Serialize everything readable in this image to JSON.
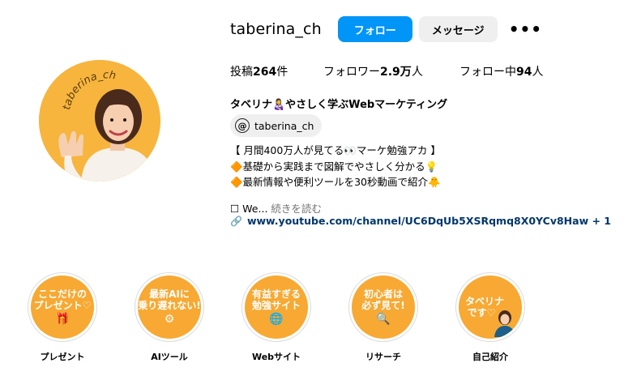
{
  "profile": {
    "username": "taberina_ch",
    "follow_label": "フォロー",
    "message_label": "メッセージ",
    "more_label": "•••",
    "avatar_ring_text": "taberina_ch"
  },
  "stats": {
    "posts_prefix": "投稿",
    "posts_count": "264",
    "posts_suffix": "件",
    "followers_prefix": "フォロワー",
    "followers_count": "2.9万",
    "followers_suffix": "人",
    "following_prefix": "フォロー中",
    "following_count": "94",
    "following_suffix": "人"
  },
  "bio": {
    "name": "タベリナ👩‍🍼やさしく学ぶWebマーケティング",
    "threads_handle": "taberina_ch",
    "line1": "【 月間400万人が見てる👀マーケ勉強アカ 】",
    "line2": "🔶基礎から実践まで図解でやさしく分かる💡",
    "line3": "🔶最新情報や便利ツールを30秒動画で紹介🐥",
    "more_prefix": "☐ We...",
    "more_link": "続きを読む",
    "link_text": "www.youtube.com/channel/UC6DqUb5XSRqmq8X0YCv8Haw + 1"
  },
  "highlights": [
    {
      "line1": "ここだけの",
      "line2": "プレゼント♡",
      "icon": "gift-icon",
      "label": "プレゼント"
    },
    {
      "line1": "最新AIに",
      "line2": "乗り遅れない!",
      "icon": "brain-icon",
      "label": "AIツール"
    },
    {
      "line1": "有益すぎる",
      "line2": "勉強サイト",
      "icon": "globe-icon",
      "label": "Webサイト"
    },
    {
      "line1": "初心者は",
      "line2": "必ず見て!",
      "icon": "magnifier-icon",
      "label": "リサーチ"
    },
    {
      "line1": "タベリナ",
      "line2": "です♡",
      "icon": "person-icon",
      "label": "自己紹介"
    }
  ],
  "colors": {
    "follow_button": "#0095f6",
    "highlight_bg": "#f7a933",
    "link": "#00376b"
  }
}
